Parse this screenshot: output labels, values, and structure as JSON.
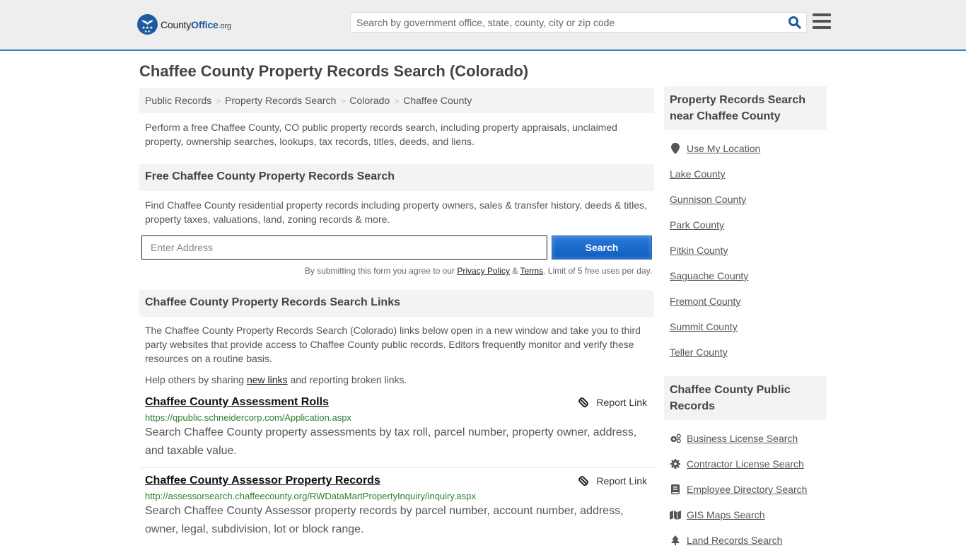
{
  "header": {
    "logo": {
      "part1": "County",
      "part2": "Office",
      "part3": ".org"
    },
    "search_placeholder": "Search by government office, state, county, city or zip code"
  },
  "page_title": "Chaffee County Property Records Search (Colorado)",
  "breadcrumb": [
    {
      "label": "Public Records"
    },
    {
      "label": "Property Records Search"
    },
    {
      "label": "Colorado"
    },
    {
      "label": "Chaffee County"
    }
  ],
  "intro": "Perform a free Chaffee County, CO public property records search, including property appraisals, unclaimed property, ownership searches, lookups, tax records, titles, deeds, and liens.",
  "free_search": {
    "heading": "Free Chaffee County Property Records Search",
    "description": "Find Chaffee County residential property records including property owners, sales & transfer history, deeds & titles, property taxes, valuations, land, zoning records & more.",
    "address_placeholder": "Enter Address",
    "button_label": "Search",
    "terms_prefix": "By submitting this form you agree to our ",
    "privacy_label": "Privacy Policy",
    "amp": " & ",
    "terms_label": "Terms",
    "terms_suffix": ". Limit of 5 free uses per day."
  },
  "links_section": {
    "heading": "Chaffee County Property Records Search Links",
    "description": "The Chaffee County Property Records Search (Colorado) links below open in a new window and take you to third party websites that provide access to Chaffee County public records. Editors frequently monitor and verify these resources on a routine basis.",
    "help_prefix": "Help others by sharing ",
    "help_link": "new links",
    "help_suffix": " and reporting broken links.",
    "report_label": "Report Link",
    "items": [
      {
        "title": "Chaffee County Assessment Rolls",
        "url": "https://qpublic.schneidercorp.com/Application.aspx",
        "description": "Search Chaffee County property assessments by tax roll, parcel number, property owner, address, and taxable value."
      },
      {
        "title": "Chaffee County Assessor Property Records",
        "url": "http://assessorsearch.chaffeecounty.org/RWDataMartPropertyInquiry/inquiry.aspx",
        "description": "Search Chaffee County Assessor property records by parcel number, account number, address, owner, legal, subdivision, lot or block range."
      }
    ]
  },
  "sidebar": {
    "nearby": {
      "heading": "Property Records Search near Chaffee County",
      "use_location": "Use My Location",
      "counties": [
        "Lake County",
        "Gunnison County",
        "Park County",
        "Pitkin County",
        "Saguache County",
        "Fremont County",
        "Summit County",
        "Teller County"
      ]
    },
    "public_records": {
      "heading": "Chaffee County Public Records",
      "items": [
        {
          "label": "Business License Search",
          "icon": "cogs-icon"
        },
        {
          "label": "Contractor License Search",
          "icon": "gear-icon"
        },
        {
          "label": "Employee Directory Search",
          "icon": "book-icon"
        },
        {
          "label": "GIS Maps Search",
          "icon": "map-icon"
        },
        {
          "label": "Land Records Search",
          "icon": "tree-icon"
        }
      ]
    }
  },
  "colors": {
    "brand_blue": "#1e5aa0",
    "header_bg": "#eeeeee",
    "header_border": "#3a80b0",
    "button_blue": "#1566c8",
    "url_green": "#2e7d32"
  }
}
